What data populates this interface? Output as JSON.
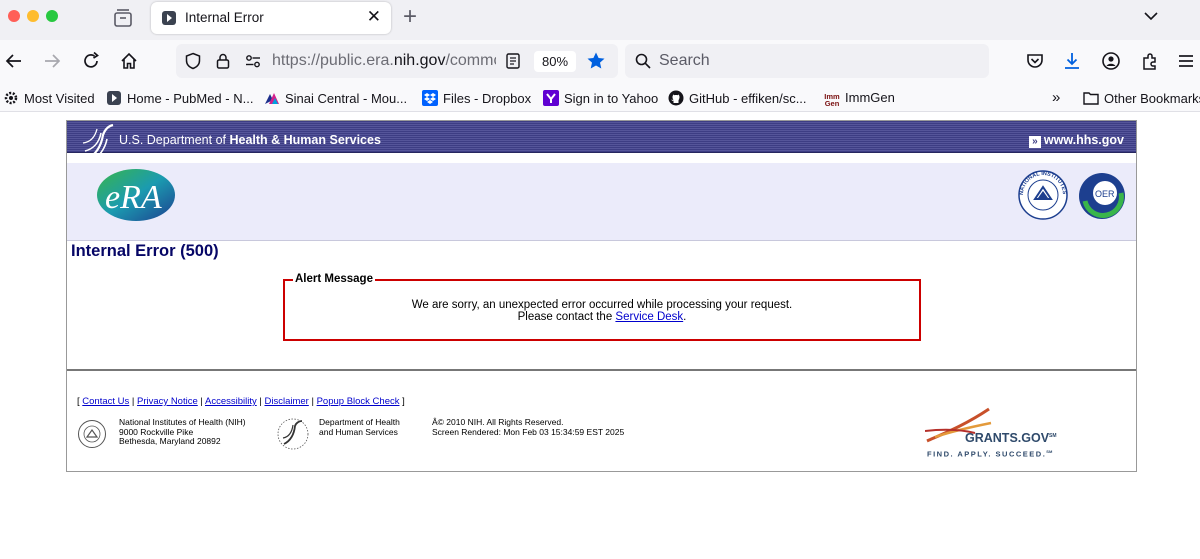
{
  "browser": {
    "tab_title": "Internal Error",
    "url_dim_start": "https://public.era.",
    "url_host": "nih.gov",
    "url_dim_end": "/commons/",
    "zoom": "80%",
    "search_placeholder": "Search",
    "bookmarks": [
      "Most Visited",
      "Home - PubMed - N...",
      "Sinai Central - Mou...",
      "Files - Dropbox",
      "Sign in to Yahoo",
      "GitHub - effiken/sc...",
      "ImmGen",
      "Other Bookmarks"
    ],
    "immgen_icon_text": [
      "Imm",
      "Gen"
    ]
  },
  "page": {
    "hhs_prefix": "U.S. Department of ",
    "hhs_bold": "Health & Human Services",
    "hhs_link": "www.hhs.gov",
    "era_logo_text": "eRA",
    "nih_seal_text": "NATIONAL INSTITUTES OF HEALTH",
    "oer_logo_text": "OER",
    "error_title": "Internal Error (500)",
    "alert_legend": "Alert Message",
    "alert_line1": "We are sorry, an unexpected error occurred while processing your request.",
    "alert_line2_prefix": "Please contact the ",
    "alert_link": "Service Desk",
    "alert_line2_suffix": "."
  },
  "footer": {
    "links": [
      "Contact Us",
      "Privacy Notice",
      "Accessibility",
      "Disclaimer",
      "Popup Block Check"
    ],
    "nih_address": [
      "National Institutes of Health (NIH)",
      "9000 Rockville Pike",
      "Bethesda, Maryland 20892"
    ],
    "dhhs": [
      "Department of Health",
      "and Human Services"
    ],
    "copyright": "Â© 2010 NIH. All Rights Reserved.",
    "rendered": "Screen Rendered: Mon Feb 03 15:34:59 EST 2025",
    "grants_title": "GRANTS.GOV",
    "grants_tm": "SM",
    "grants_tagline": "FIND. APPLY. SUCCEED.",
    "grants_tagline_tm": "SM"
  },
  "colors": {
    "hhs_bar": "#3d3d84",
    "banner": "#ebebfa",
    "error_title": "#060666",
    "alert_border": "#cc0000",
    "link": "#0000cc",
    "bookmark_star": "#0060df"
  }
}
